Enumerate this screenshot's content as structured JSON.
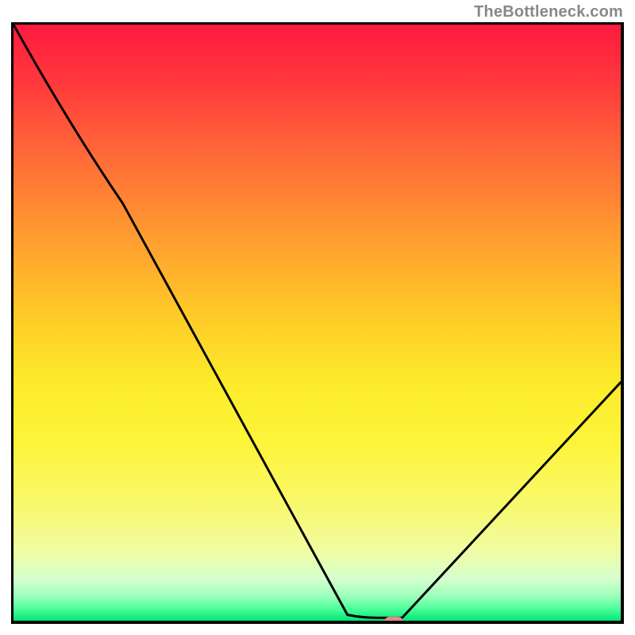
{
  "watermark": "TheBottleneck.com",
  "chart_data": {
    "type": "line",
    "title": "",
    "xlabel": "",
    "ylabel": "",
    "xlim": [
      0,
      100
    ],
    "ylim": [
      0,
      100
    ],
    "grid": false,
    "x": [
      0,
      18,
      55,
      60,
      64,
      100
    ],
    "values": [
      100,
      70,
      1,
      0.5,
      0.5,
      40
    ],
    "marker": {
      "x": 62,
      "y": 0.5
    }
  },
  "colors": {
    "top": "#ff1a3f",
    "bottom": "#00e676",
    "curve": "#000000",
    "marker": "#e28a8a",
    "watermark": "#888888"
  }
}
